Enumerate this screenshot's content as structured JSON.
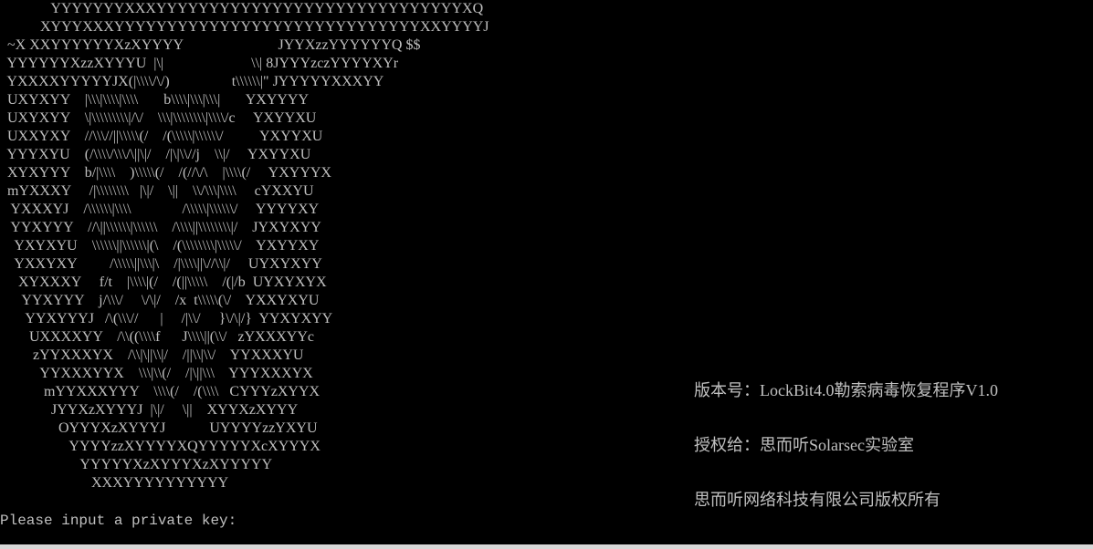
{
  "console": {
    "background": "#000000",
    "foreground": "#c0c0c0",
    "ascii_art": [
      "              YYYYYYYXXXYYYYYYYYYYYYYYYYYYYYYYYYYYYYYXQ",
      "           XYYYXXXYYYYYYYYYYYYYYYYYYYYYYYYYYYYYXXYYYYJ",
      "  ~X XXYYYYYYXzXYYYY                          JYYXzzYYYYYYQ $$",
      "  YYYYYYXzzXYYYU  |\\|                        \\\\| 8JYYYzczYYYYXYr",
      "  YXXXXYYYYYJX(|\\\\\\\\/\\/)                 t\\\\\\\\\\\\|\" JYYYYYXXXYY",
      "  UXYXYY    |\\\\\\|\\\\\\\\|\\\\\\\\       b\\\\\\\\|\\\\\\|\\\\\\|       YXYYYY",
      "  UXYXYY    \\|\\\\\\\\\\\\\\\\\\|/\\/    \\\\\\|\\\\\\\\\\\\\\\\|\\\\\\\\/c     YXYYXU",
      "  UXXYXY    //\\\\\\//||\\\\\\\\\\(/    /(\\\\\\\\\\|\\\\\\\\\\\\/          YXYYXU",
      "  YYYXYU    (/\\\\\\\\/\\\\\\/\\||\\|/    /|\\|\\\\//j    \\\\|/     YXYYXU",
      "  XYXYYY    b/|\\\\\\\\    )\\\\\\\\\\(/    /(//\\/\\    |\\\\\\\\(/     YXYYYX",
      "  mYXXXY     /|\\\\\\\\\\\\\\\\   |\\|/    \\||    \\\\/\\\\\\|\\\\\\\\     cYXXYU",
      "   YXXXYJ    /\\\\\\\\\\\\|\\\\\\\\              /\\\\\\\\\\|\\\\\\\\\\\\/     YYYYXY",
      "   YYXYYY    //\\||\\\\\\\\\\\\|\\\\\\\\\\\\    /\\\\\\\\||\\\\\\\\\\\\\\\\|/    JYXYXYY",
      "    YXYXYU    \\\\\\\\\\\\||\\\\\\\\\\\\|(\\    /(\\\\\\\\\\\\\\\\|\\\\\\\\\\/    YXYYXY",
      "    YXXYXY         /\\\\\\\\\\||\\\\\\|\\    /|\\\\\\\\||\\//\\\\|/     UYXYXYY",
      "     XYXXXY     f/t    |\\\\\\\\|(/    /(||\\\\\\\\\\    /(|/b  UYXYXYX",
      "      YYXYYY    j/\\\\\\/     \\/\\|/    /x  t\\\\\\\\\\(\\/    YXXYXYU",
      "       YYXYYYJ   /\\(\\\\\\//      |     /|\\\\/     }\\/\\|/}  YYXYXYY",
      "        UXXXXYY    /\\\\((\\\\\\\\f      J\\\\\\\\||(\\\\/   zYXXXYYc",
      "         zYYXXXYX    /\\\\|\\||\\\\|/    /||\\\\|\\\\/    YYXXXYU",
      "           YYXXXYYX    \\\\\\|\\\\(/    /|\\||\\\\\\    YYYXXXYX",
      "            mYYXXXYYY    \\\\\\\\(/    /(\\\\\\\\   CYYYzXYYX",
      "              JYYXzXYYYJ  |\\|/     \\||    XYYXzXYYY",
      "                OYYYXzXYYYJ            UYYYYzzYXYU",
      "                   YYYYzzXYYYYXQYYYYYXcXYYYX",
      "                      YYYYYXzXYYYXzXYYYYY",
      "                         XXXYYYYYYYYYY"
    ],
    "info_lines": [
      "版本号：LockBit4.0勒索病毒恢复程序V1.0",
      "授权给：思而听Solarsec实验室",
      "思而听网络科技有限公司版权所有"
    ],
    "prompt": "Please input a private key:",
    "input_value": ""
  }
}
